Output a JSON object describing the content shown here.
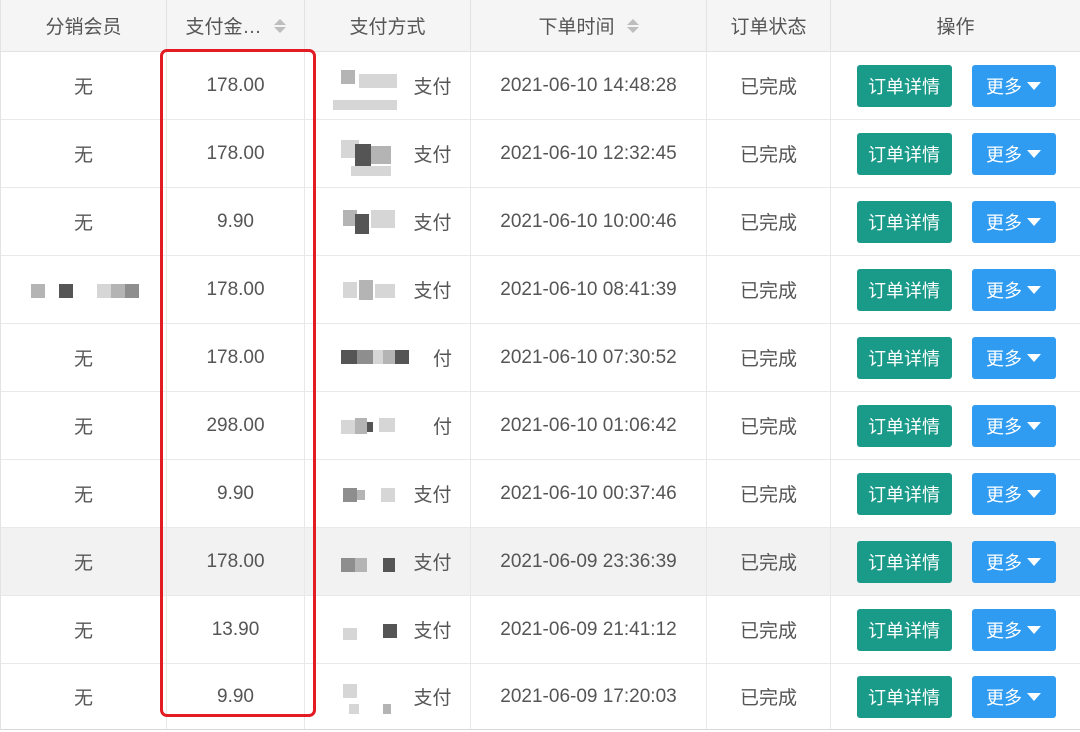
{
  "header": {
    "col_member": "分销会员",
    "col_amount": "支付金…",
    "col_method": "支付方式",
    "col_time": "下单时间",
    "col_status": "订单状态",
    "col_actions": "操作"
  },
  "buttons": {
    "detail": "订单详情",
    "more": "更多"
  },
  "rows": [
    {
      "member": "无",
      "amount": "178.00",
      "method_visible": "支付",
      "time": "2021-06-10 14:48:28",
      "status": "已完成"
    },
    {
      "member": "无",
      "amount": "178.00",
      "method_visible": "支付",
      "time": "2021-06-10 12:32:45",
      "status": "已完成"
    },
    {
      "member": "无",
      "amount": "9.90",
      "method_visible": "支付",
      "time": "2021-06-10 10:00:46",
      "status": "已完成"
    },
    {
      "member": "",
      "amount": "178.00",
      "method_visible": "支付",
      "time": "2021-06-10 08:41:39",
      "status": "已完成"
    },
    {
      "member": "无",
      "amount": "178.00",
      "method_visible": "付",
      "time": "2021-06-10 07:30:52",
      "status": "已完成"
    },
    {
      "member": "无",
      "amount": "298.00",
      "method_visible": "付",
      "time": "2021-06-10 01:06:42",
      "status": "已完成"
    },
    {
      "member": "无",
      "amount": "9.90",
      "method_visible": "支付",
      "time": "2021-06-10 00:37:46",
      "status": "已完成"
    },
    {
      "member": "无",
      "amount": "178.00",
      "method_visible": "支付",
      "time": "2021-06-09 23:36:39",
      "status": "已完成"
    },
    {
      "member": "无",
      "amount": "13.90",
      "method_visible": "支付",
      "time": "2021-06-09 21:41:12",
      "status": "已完成"
    },
    {
      "member": "无",
      "amount": "9.90",
      "method_visible": "支付",
      "time": "2021-06-09 17:20:03",
      "status": "已完成"
    }
  ],
  "colors": {
    "detail_button": "#1a9b8a",
    "more_button": "#2f9cf2",
    "highlight_box": "#e31b23",
    "header_bg": "#f5f5f5"
  }
}
